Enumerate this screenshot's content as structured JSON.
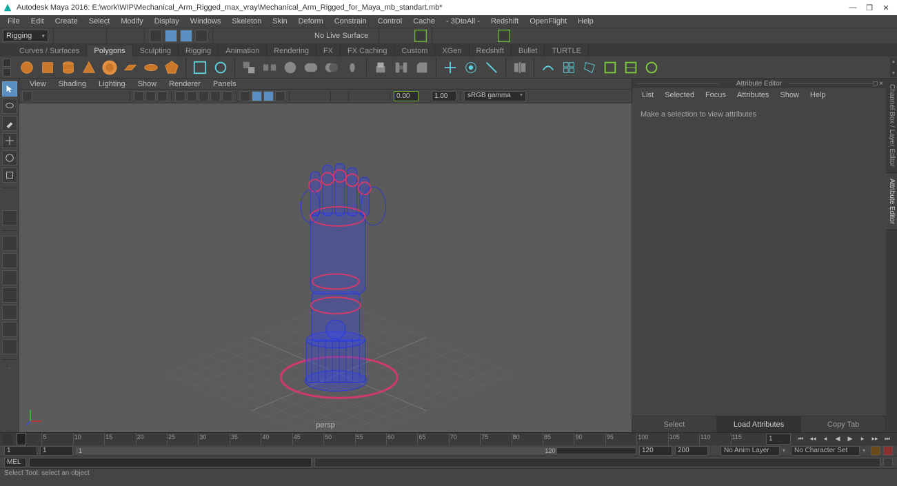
{
  "window": {
    "title": "Autodesk Maya 2016: E:\\work\\WIP\\Mechanical_Arm_Rigged_max_vray\\Mechanical_Arm_Rigged_for_Maya_mb_standart.mb*"
  },
  "menu": [
    "File",
    "Edit",
    "Create",
    "Select",
    "Modify",
    "Display",
    "Windows",
    "Skeleton",
    "Skin",
    "Deform",
    "Constrain",
    "Control",
    "Cache",
    "- 3DtoAll -",
    "Redshift",
    "OpenFlight",
    "Help"
  ],
  "mode": "Rigging",
  "no_live": "No Live Surface",
  "shelf_tabs": [
    "Curves / Surfaces",
    "Polygons",
    "Sculpting",
    "Rigging",
    "Animation",
    "Rendering",
    "FX",
    "FX Caching",
    "Custom",
    "XGen",
    "Redshift",
    "Bullet",
    "TURTLE"
  ],
  "shelf_active": 1,
  "panel_menu": [
    "View",
    "Shading",
    "Lighting",
    "Show",
    "Renderer",
    "Panels"
  ],
  "near_field": "0.00",
  "far_field": "1.00",
  "gamma": "sRGB gamma",
  "attr": {
    "title": "Attribute Editor",
    "menu": [
      "List",
      "Selected",
      "Focus",
      "Attributes",
      "Show",
      "Help"
    ],
    "body": "Make a selection to view attributes",
    "buttons": {
      "select": "Select",
      "load": "Load Attributes",
      "copy": "Copy Tab"
    }
  },
  "side_tabs": [
    "Channel Box / Layer Editor",
    "Attribute Editor"
  ],
  "viewport": {
    "camera": "persp"
  },
  "timeline": {
    "ticks": [
      1,
      5,
      10,
      15,
      20,
      25,
      30,
      35,
      40,
      45,
      50,
      55,
      60,
      65,
      70,
      75,
      80,
      85,
      90,
      95,
      100,
      105,
      110,
      115
    ],
    "current": "1",
    "start_outer": "1",
    "start_inner": "1",
    "range_label_left": "1",
    "range_label_right": "120",
    "end_inner": "120",
    "end_outer": "200"
  },
  "anim_layer": "No Anim Layer",
  "char_set": "No Character Set",
  "cmd_lang": "MEL",
  "help": "Select Tool: select an object"
}
